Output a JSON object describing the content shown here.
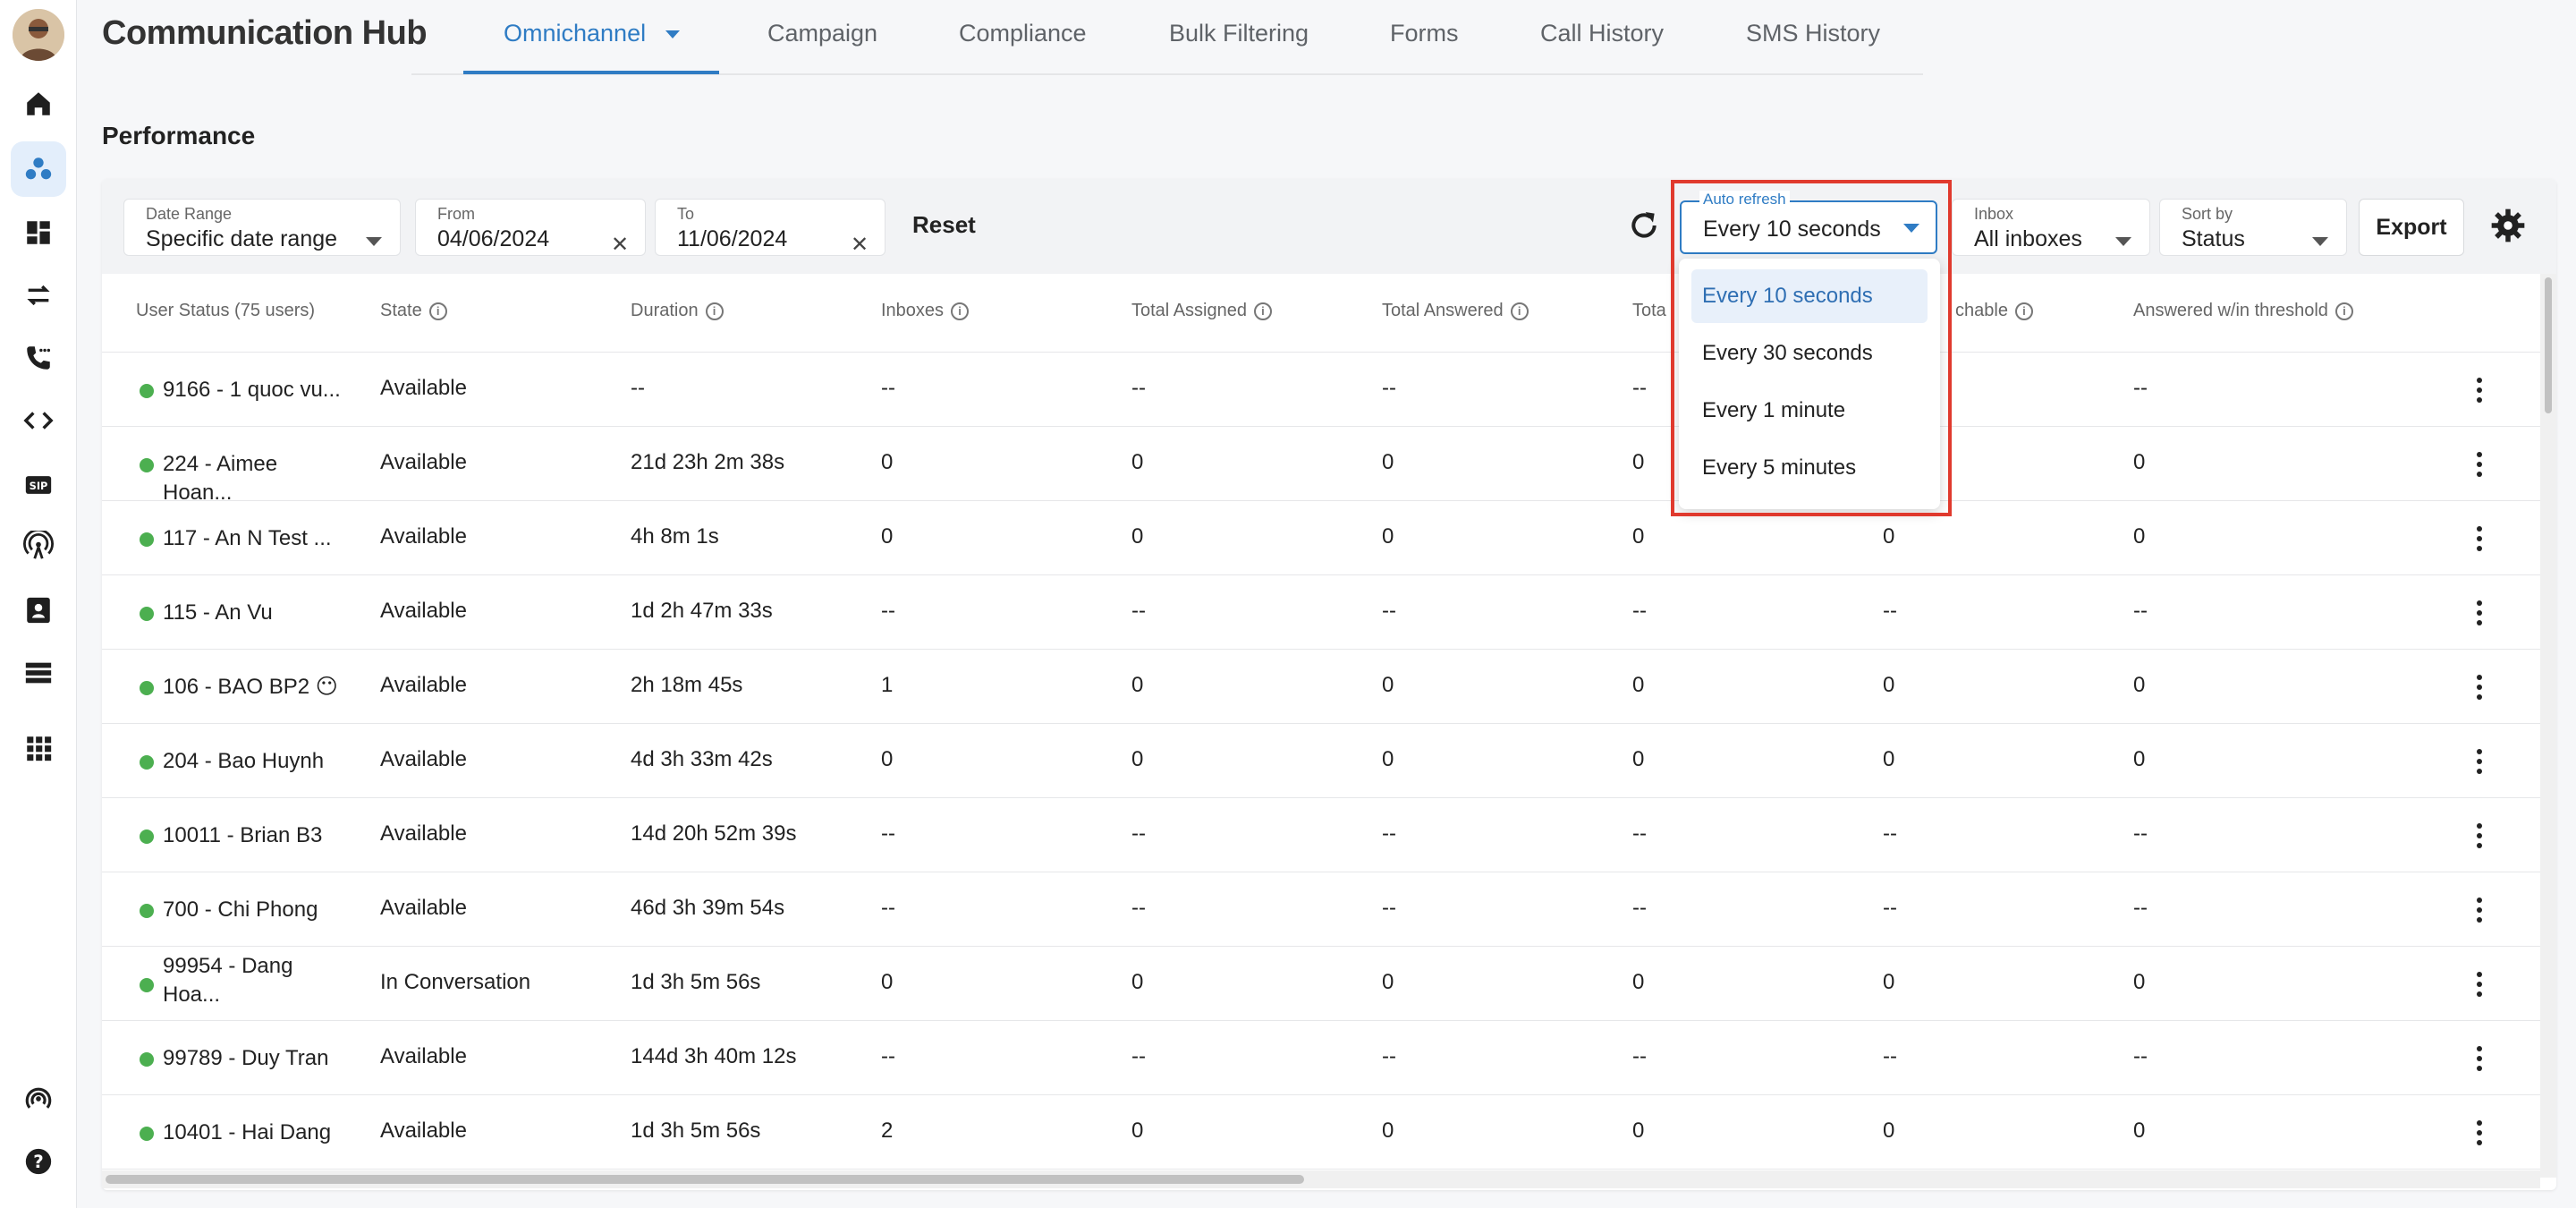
{
  "app": {
    "title": "Communication Hub",
    "tabs": [
      "Omnichannel",
      "Campaign",
      "Compliance",
      "Bulk Filtering",
      "Forms",
      "Call History",
      "SMS History"
    ],
    "active_tab": "Omnichannel",
    "accent_color": "#2f7cc4"
  },
  "sidebar": {
    "icons": [
      "home-icon",
      "team-icon",
      "dashboard-icon",
      "transfer-icon",
      "call-icon",
      "code-icon",
      "sip-icon",
      "broadcast-icon",
      "contacts-icon",
      "storage-icon",
      "apps-icon",
      "wireless-icon",
      "help-icon"
    ]
  },
  "section": {
    "title": "Performance"
  },
  "filters": {
    "date_range": {
      "label": "Date Range",
      "value": "Specific date range"
    },
    "from": {
      "label": "From",
      "value": "04/06/2024"
    },
    "to": {
      "label": "To",
      "value": "11/06/2024"
    },
    "reset_label": "Reset",
    "auto_refresh": {
      "label": "Auto refresh",
      "value": "Every 10 seconds"
    },
    "inbox": {
      "label": "Inbox",
      "value": "All inboxes"
    },
    "sort_by": {
      "label": "Sort by",
      "value": "Status"
    },
    "export_label": "Export"
  },
  "dropdown": {
    "options": [
      "Every 10 seconds",
      "Every 30 seconds",
      "Every 1 minute",
      "Every 5 minutes"
    ],
    "selected": "Every 10 seconds"
  },
  "table": {
    "columns": [
      "User Status (75 users)",
      "State",
      "Duration",
      "Inboxes",
      "Total Assigned",
      "Total Answered",
      "Tota",
      "chable",
      "Answered w/in threshold"
    ],
    "rows": [
      {
        "user": "9166 - 1 quoc vu...",
        "state": "Available",
        "duration": "--",
        "inboxes": "--",
        "assigned": "--",
        "answered": "--",
        "total": "--",
        "reachable": "",
        "threshold": "--"
      },
      {
        "user": "224 - Aimee Hoan...",
        "state": "Available",
        "duration": "21d 23h 2m 38s",
        "inboxes": "0",
        "assigned": "0",
        "answered": "0",
        "total": "0",
        "reachable": "",
        "threshold": "0"
      },
      {
        "user": "117 - An N Test ...",
        "state": "Available",
        "duration": "4h 8m 1s",
        "inboxes": "0",
        "assigned": "0",
        "answered": "0",
        "total": "0",
        "reachable": "0",
        "threshold": "0"
      },
      {
        "user": "115 - An Vu",
        "state": "Available",
        "duration": "1d 2h 47m 33s",
        "inboxes": "--",
        "assigned": "--",
        "answered": "--",
        "total": "--",
        "reachable": "--",
        "threshold": "--"
      },
      {
        "user": "106 - BAO BP2 😶",
        "state": "Available",
        "duration": "2h 18m 45s",
        "inboxes": "1",
        "assigned": "0",
        "answered": "0",
        "total": "0",
        "reachable": "0",
        "threshold": "0"
      },
      {
        "user": "204 - Bao Huynh",
        "state": "Available",
        "duration": "4d 3h 33m 42s",
        "inboxes": "0",
        "assigned": "0",
        "answered": "0",
        "total": "0",
        "reachable": "0",
        "threshold": "0"
      },
      {
        "user": "10011 - Brian B3",
        "state": "Available",
        "duration": "14d 20h 52m 39s",
        "inboxes": "--",
        "assigned": "--",
        "answered": "--",
        "total": "--",
        "reachable": "--",
        "threshold": "--"
      },
      {
        "user": "700 - Chi Phong",
        "state": "Available",
        "duration": "46d 3h 39m 54s",
        "inboxes": "--",
        "assigned": "--",
        "answered": "--",
        "total": "--",
        "reachable": "--",
        "threshold": "--"
      },
      {
        "user": "99954 - Dang Hoa...",
        "state": "In Conversation",
        "duration": "1d 3h 5m 56s",
        "inboxes": "0",
        "assigned": "0",
        "answered": "0",
        "total": "0",
        "reachable": "0",
        "threshold": "0"
      },
      {
        "user": "99789 - Duy Tran",
        "state": "Available",
        "duration": "144d 3h 40m 12s",
        "inboxes": "--",
        "assigned": "--",
        "answered": "--",
        "total": "--",
        "reachable": "--",
        "threshold": "--"
      },
      {
        "user": "10401 - Hai Dang",
        "state": "Available",
        "duration": "1d 3h 5m 56s",
        "inboxes": "2",
        "assigned": "0",
        "answered": "0",
        "total": "0",
        "reachable": "0",
        "threshold": "0"
      }
    ]
  }
}
